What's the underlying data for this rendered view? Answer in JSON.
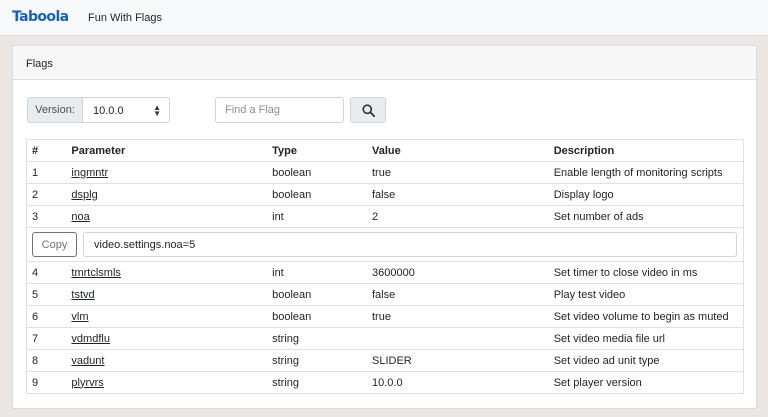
{
  "navbar": {
    "logo": "Taboola",
    "title": "Fun With Flags"
  },
  "card": {
    "header": "Flags"
  },
  "toolbar": {
    "version_label": "Version:",
    "version_value": "10.0.0",
    "search_placeholder": "Find a Flag",
    "search_value": ""
  },
  "table": {
    "headers": [
      "#",
      "Parameter",
      "Type",
      "Value",
      "Description"
    ],
    "rows": [
      {
        "num": "1",
        "param": "ingmntr",
        "type": "boolean",
        "value": "true",
        "desc": "Enable length of monitoring scripts"
      },
      {
        "num": "2",
        "param": "dsplg",
        "type": "boolean",
        "value": "false",
        "desc": "Display logo"
      },
      {
        "num": "3",
        "param": "noa",
        "type": "int",
        "value": "2",
        "desc": "Set number of ads"
      },
      {
        "num": "4",
        "param": "tmrtclsmls",
        "type": "int",
        "value": "3600000",
        "desc": "Set timer to close video in ms"
      },
      {
        "num": "5",
        "param": "tstvd",
        "type": "boolean",
        "value": "false",
        "desc": "Play test video"
      },
      {
        "num": "6",
        "param": "vlm",
        "type": "boolean",
        "value": "true",
        "desc": "Set video volume to begin as muted"
      },
      {
        "num": "7",
        "param": "vdmdflu",
        "type": "string",
        "value": "",
        "desc": "Set video media file url"
      },
      {
        "num": "8",
        "param": "vadunt",
        "type": "string",
        "value": "SLIDER",
        "desc": "Set video ad unit type"
      },
      {
        "num": "9",
        "param": "plyrvrs",
        "type": "string",
        "value": "10.0.0",
        "desc": "Set player version"
      }
    ],
    "copy_row": {
      "button": "Copy",
      "value": "video.settings.noa=5"
    }
  },
  "colors": {
    "brand": "#1b5fb0",
    "header_bg": "#f7f7f7",
    "page_bg": "#e9e6e4"
  },
  "icons": {
    "search": "magnifier-icon",
    "select": "updown-caret-icon"
  }
}
